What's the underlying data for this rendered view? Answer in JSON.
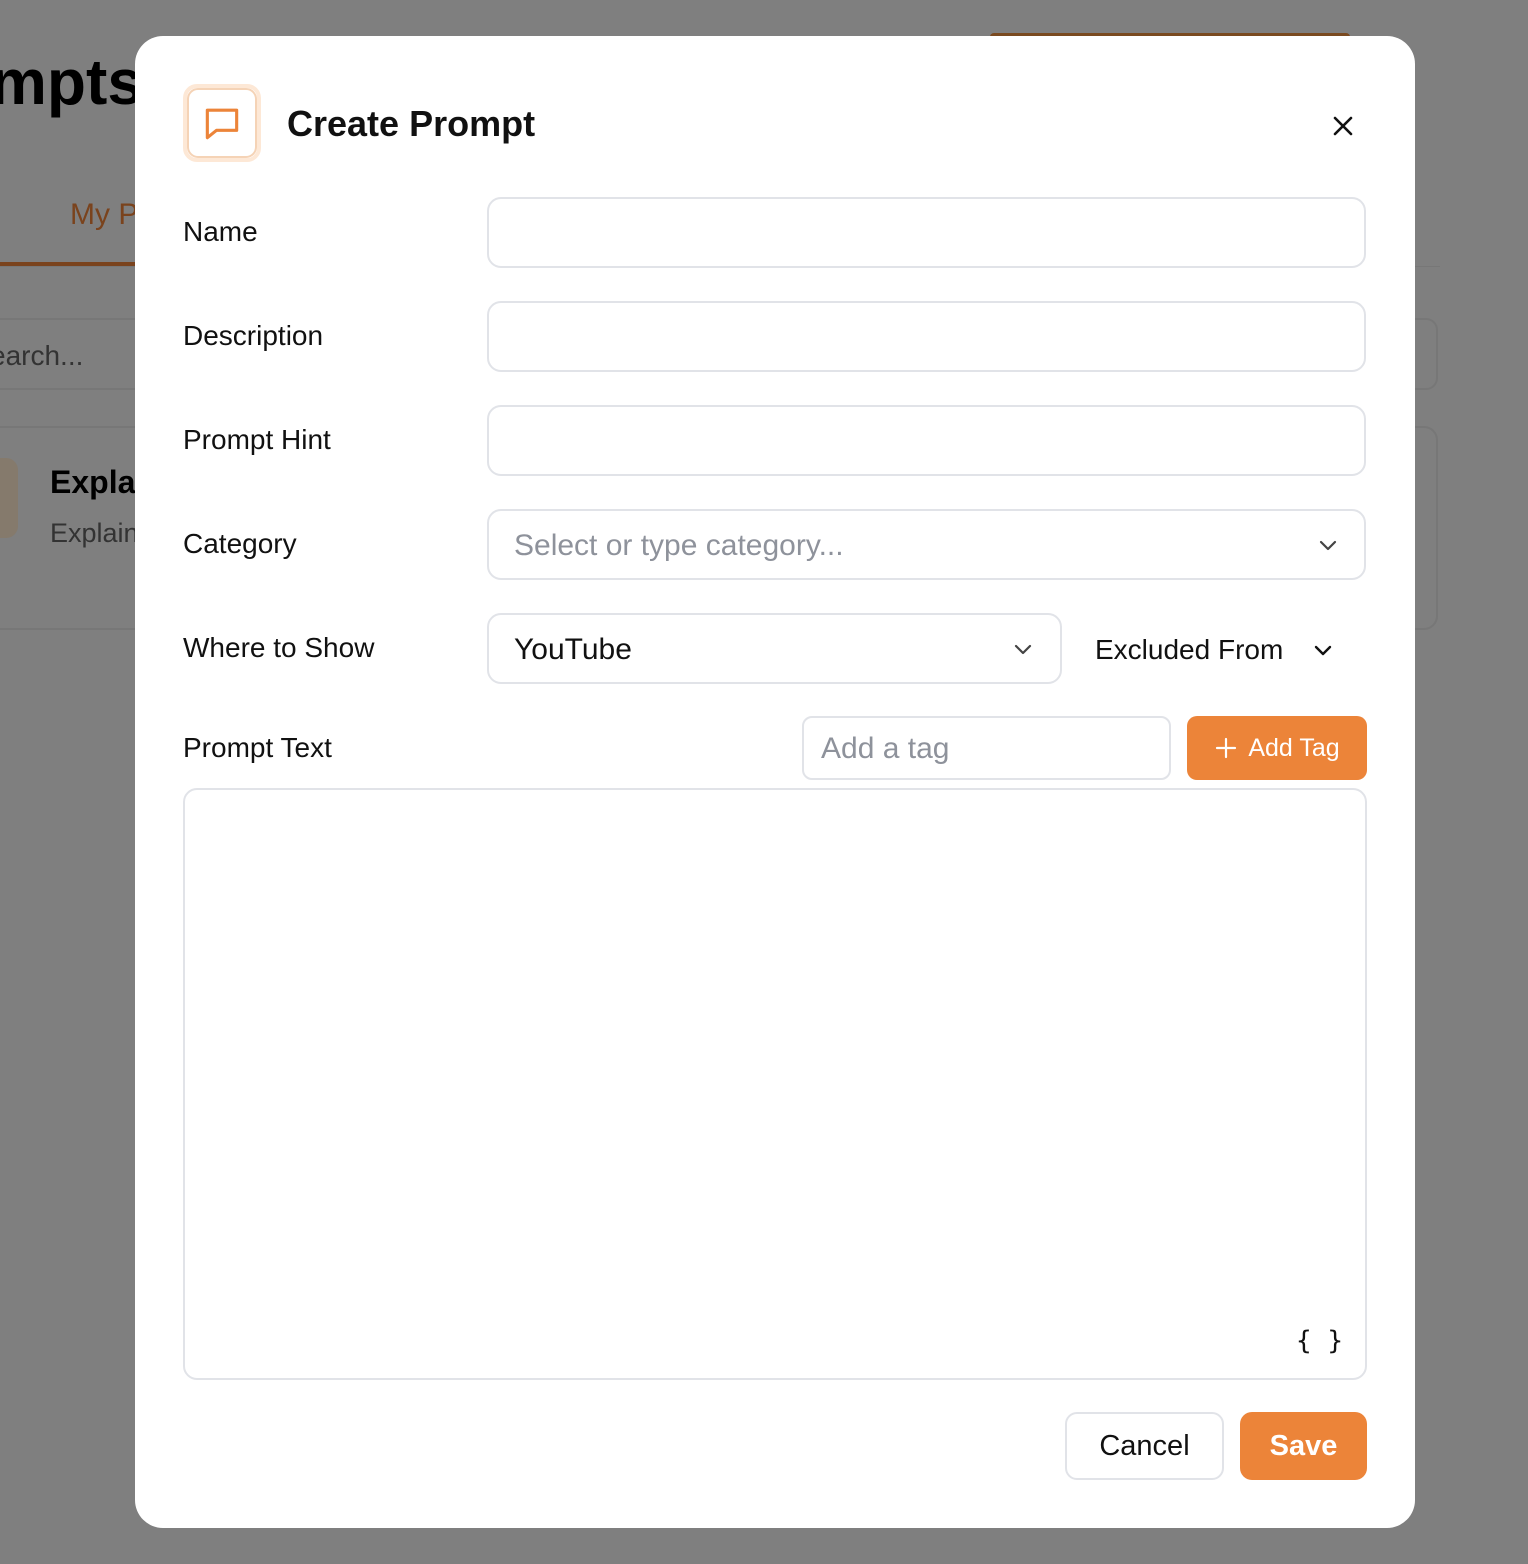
{
  "background": {
    "page_title": "mpts",
    "tab_label": "My P",
    "search_placeholder": "earch...",
    "card_title": "Explai",
    "card_description": "Explain"
  },
  "modal": {
    "title": "Create Prompt",
    "icon": "message-square-icon",
    "close_icon": "close-icon",
    "fields": {
      "name": {
        "label": "Name",
        "value": ""
      },
      "description": {
        "label": "Description",
        "value": ""
      },
      "prompt_hint": {
        "label": "Prompt Hint",
        "value": ""
      },
      "category": {
        "label": "Category",
        "placeholder": "Select or type category..."
      },
      "where_to_show": {
        "label": "Where to Show",
        "selected": "YouTube"
      },
      "excluded_from": {
        "label": "Excluded From"
      },
      "prompt_text": {
        "label": "Prompt Text",
        "value": "",
        "variables_icon": "{ }"
      },
      "tag": {
        "placeholder": "Add a tag",
        "button_label": "Add Tag"
      }
    },
    "buttons": {
      "cancel": "Cancel",
      "save": "Save"
    }
  },
  "colors": {
    "accent": "#ec8439",
    "overlay": "#7f7f7f",
    "border": "#e1e3e8",
    "placeholder": "#8e929b"
  }
}
